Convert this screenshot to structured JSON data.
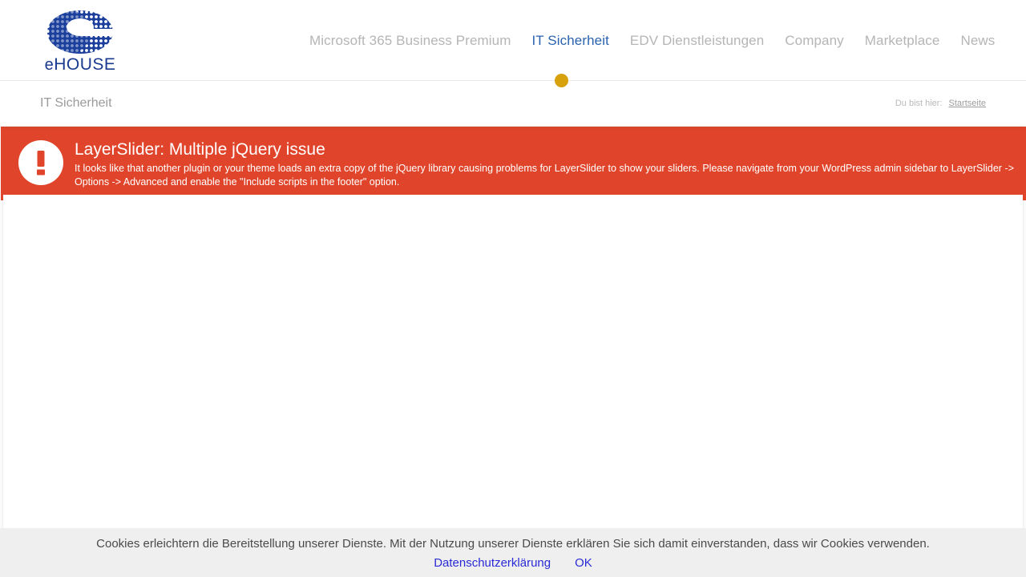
{
  "header": {
    "logo": {
      "icon": "ehouse-e-logo-icon",
      "text_prefix": "e",
      "text_suffix": "HOUSE",
      "color": "#1a3a8f"
    },
    "nav": [
      {
        "label": "Microsoft 365 Business Premium",
        "active": false
      },
      {
        "label": "IT Sicherheit",
        "active": true
      },
      {
        "label": "EDV Dienstleistungen",
        "active": false
      },
      {
        "label": "Company",
        "active": false
      },
      {
        "label": "Marketplace",
        "active": false
      },
      {
        "label": "News",
        "active": false
      }
    ],
    "accent_dot_color": "#d6a10a",
    "active_nav_color": "#2a62b0",
    "inactive_nav_color": "#b5b5b5"
  },
  "breadcrumb": {
    "page_title": "IT Sicherheit",
    "prefix_label": "Du bist hier:",
    "current": "Startseite"
  },
  "error_banner": {
    "icon": "exclamation-circle-icon",
    "title": "LayerSlider: Multiple jQuery issue",
    "description": "It looks like that another plugin or your theme loads an extra copy of the jQuery library causing problems for LayerSlider to show your sliders. Please navigate from your WordPress admin sidebar to LayerSlider -> Options -> Advanced and enable the \"Include scripts in the footer\" option.",
    "background_color": "#e0452b",
    "text_color": "#ffffff"
  },
  "cookie_notice": {
    "text": "Cookies erleichtern die Bereitstellung unserer Dienste. Mit der Nutzung unserer Dienste erklären Sie sich damit einverstanden, dass wir Cookies verwenden.",
    "privacy_link": "Datenschutzerklärung",
    "accept_label": "OK",
    "close_icon": "close-circle-icon",
    "background_color": "#efefef",
    "link_color": "#2a2ad6"
  }
}
